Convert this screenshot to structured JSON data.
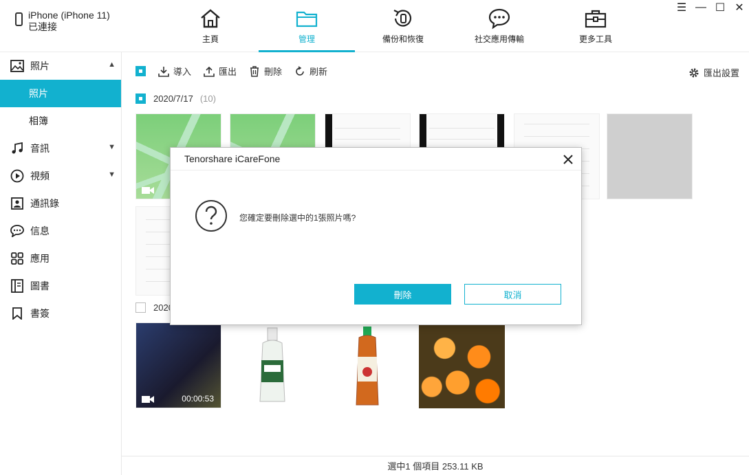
{
  "device": {
    "name": "iPhone (iPhone 11)",
    "status": "已連接"
  },
  "nav": [
    {
      "label": "主頁",
      "icon": "home-icon"
    },
    {
      "label": "管理",
      "icon": "folder-icon"
    },
    {
      "label": "備份和恢復",
      "icon": "backup-restore-icon"
    },
    {
      "label": "社交應用傳輸",
      "icon": "chat-icon"
    },
    {
      "label": "更多工具",
      "icon": "toolbox-icon"
    }
  ],
  "window": {
    "menu": "☰",
    "minimize": "—",
    "maximize": "☐",
    "close": "✕"
  },
  "sidebar": {
    "photos": "照片",
    "photos_sub": [
      "照片",
      "相簿"
    ],
    "items": [
      "音訊",
      "視頻",
      "通訊錄",
      "信息",
      "應用",
      "圖書",
      "書簽"
    ]
  },
  "toolbar": {
    "import": "導入",
    "export": "匯出",
    "delete": "刪除",
    "refresh": "刷新",
    "export_settings": "匯出設置"
  },
  "groups": [
    {
      "date": "2020/7/17",
      "count": "(10)"
    },
    {
      "date": "2020"
    }
  ],
  "video_duration": "00:00:53",
  "status": "選中1 個項目 253.11 KB",
  "dialog": {
    "title": "Tenorshare iCareFone",
    "message": "您確定要刪除選中的1張照片嗎?",
    "confirm": "刪除",
    "cancel": "取消"
  },
  "colors": {
    "accent": "#12b1cf"
  }
}
